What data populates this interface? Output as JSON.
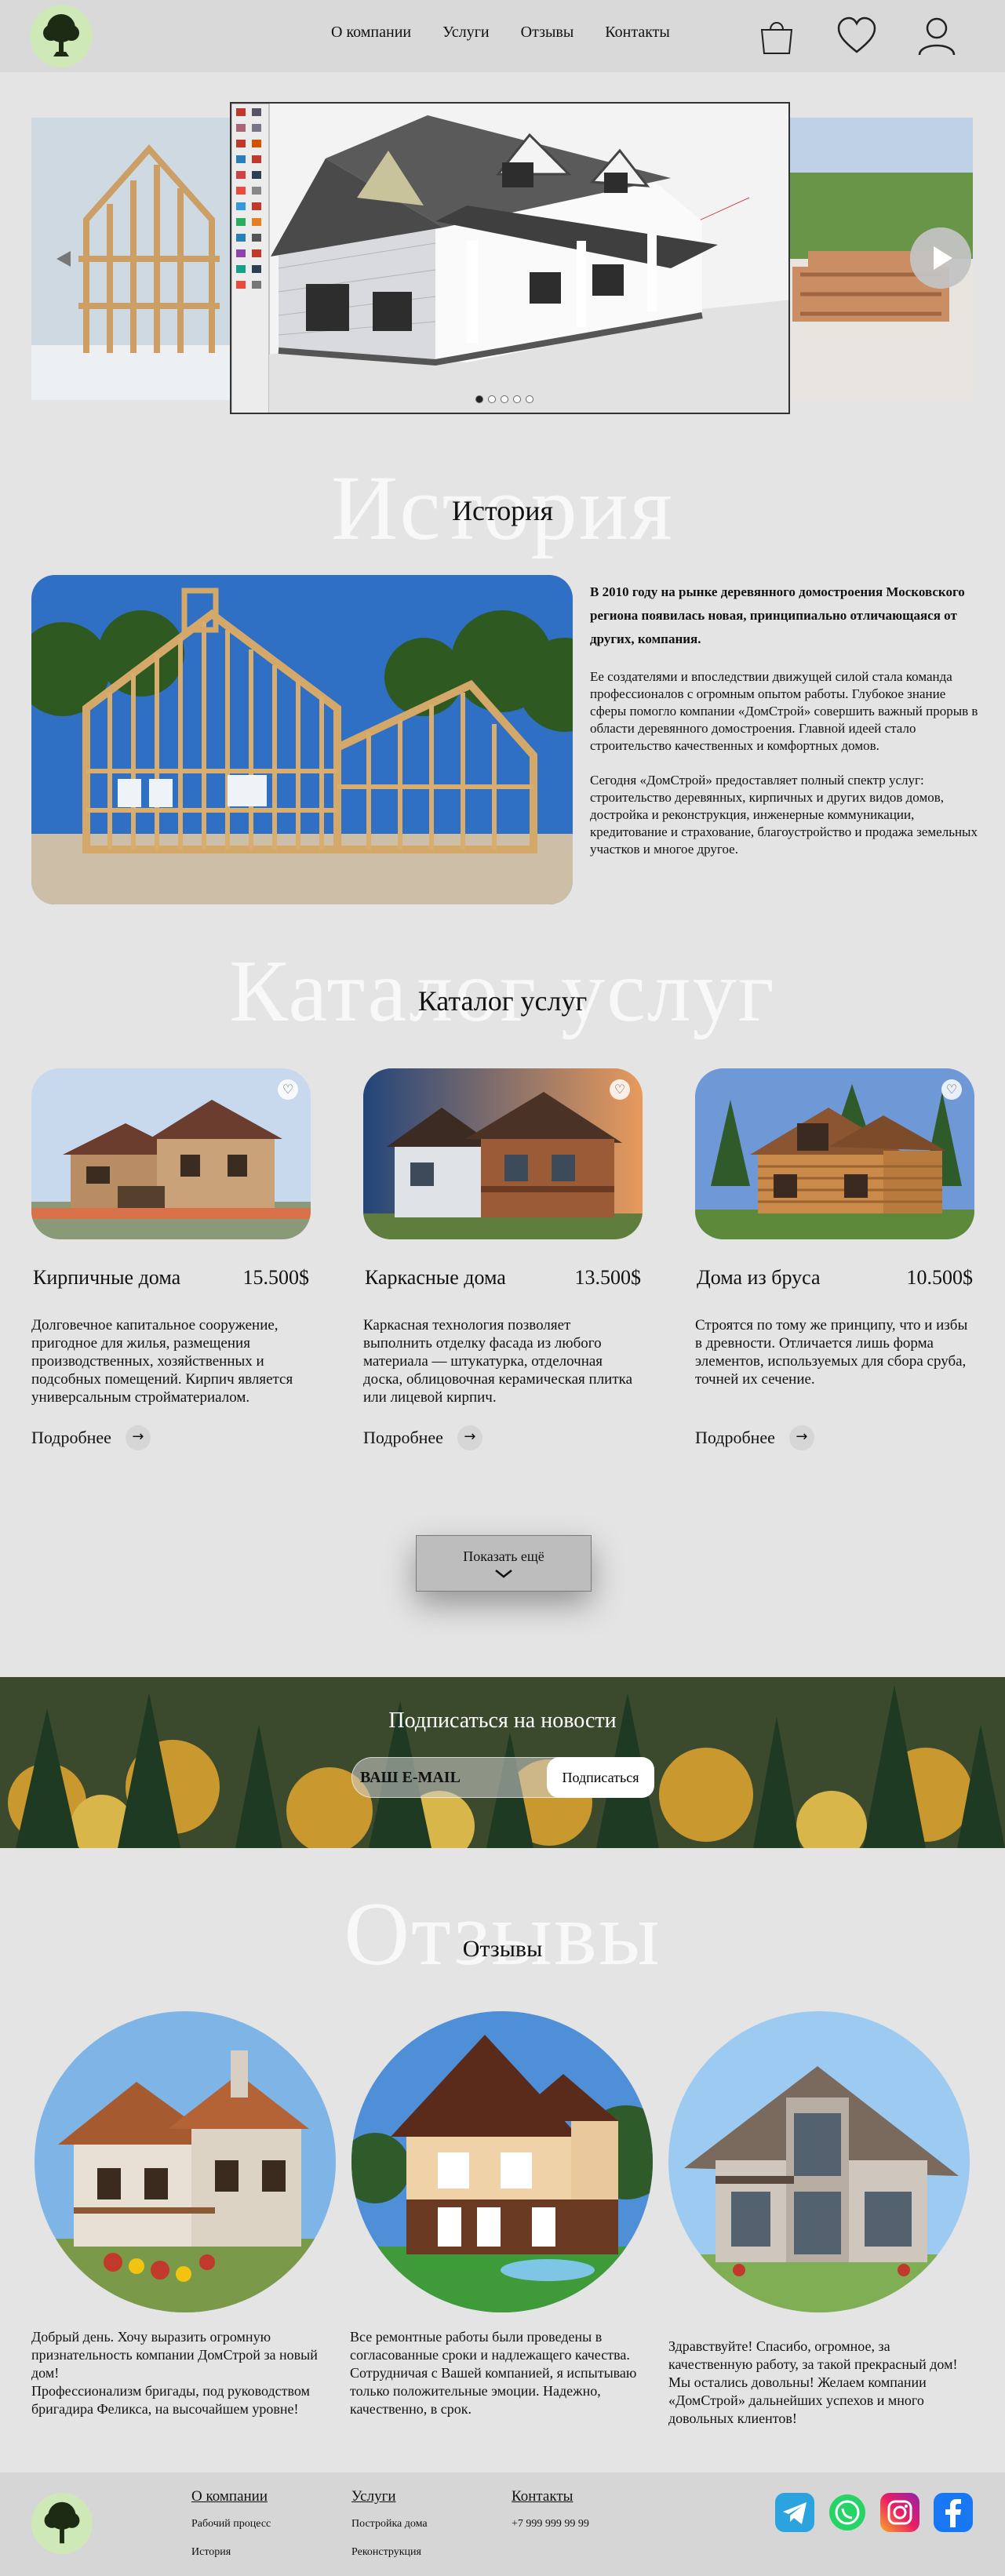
{
  "header": {
    "nav": [
      "О компании",
      "Услуги",
      "Отзывы",
      "Контакты"
    ]
  },
  "hero": {
    "slides": 5,
    "active_slide": 1
  },
  "history": {
    "ghost": "История",
    "title": "История",
    "lead": "В 2010 году на рынке деревянного домостроения Московского региона появилась новая, принципиально отличающаяся от других, компания.",
    "p1": "Ее создателями и впоследствии движущей силой стала команда профессионалов с огромным опытом работы. Глубокое знание сферы помогло компании «ДомСтрой» совершить важный прорыв в области деревянного домостроения. Главной идеей стало строительство качественных и комфортных домов.",
    "p2": "Сегодня «ДомСтрой» предоставляет полный спектр услуг: строительство деревянных, кирпичных и других видов домов, достройка и реконструкция, инженерные коммуникации, кредитование и страхование, благоустройство и продажа земельных участков и многое другое."
  },
  "catalog": {
    "ghost": "Каталог услуг",
    "title": "Каталог услуг",
    "cards": [
      {
        "name": "Кирпичные дома",
        "price": "15.500$",
        "desc": "Долговечное капитальное сооружение, пригодное для жилья, размещения производственных, хозяйственных и подсобных помещений. Кирпич является универсальным стройматериалом.",
        "more": "Подробнее"
      },
      {
        "name": "Каркасные дома",
        "price": "13.500$",
        "desc": "Каркасная технология позволяет выполнить отделку фасада из любого материала — штукатурка, отделочная доска, облицовочная керамическая плитка или лицевой кирпич.",
        "more": "Подробнее"
      },
      {
        "name": "Дома из бруса",
        "price": "10.500$",
        "desc": "Строятся по тому же принципу, что и избы в древности. Отличается лишь форма элементов, используемых для сбора сруба, точней их сечение.",
        "more": "Подробнее"
      }
    ],
    "show_more": "Показать ещё"
  },
  "newsletter": {
    "title": "Подписаться на новости",
    "email_placeholder": "ВАШ E-MAIL",
    "button": "Подписаться"
  },
  "reviews": {
    "ghost": "Отзывы",
    "title": "Отзывы",
    "items": [
      "Добрый день. Хочу выразить огромную признательность компании ДомСтрой за новый дом!\nПрофессионализм бригады, под руководством бригадира Феликса, на высочайшем уровне!",
      "Все ремонтные работы были проведены в согласованные сроки и надлежащего качества.\nСотрудничая с Вашей компанией, я испытываю только положительные эмоции. Надежно, качественно, в срок.",
      "Здравствуйте! Спасибо, огромное, за качественную работу, за такой прекрасный дом! Мы остались довольны! Желаем компании «ДомСтрой» дальнейших успехов и много довольных клиентов!"
    ]
  },
  "footer": {
    "col1": {
      "head": "О компании",
      "links": [
        "Рабочий процесс",
        "История"
      ]
    },
    "col2": {
      "head": "Услуги",
      "links": [
        "Постройка дома",
        "Реконструкция"
      ]
    },
    "col3": {
      "head": "Контакты",
      "links": [
        "+7 999 999 99 99"
      ]
    }
  },
  "colors": {
    "background": "#e4e4e4",
    "header": "#d9d9d9",
    "footer": "#d6d6d6",
    "telegram": "#2aa3df",
    "whatsapp": "#25d366",
    "facebook": "#1877f2"
  }
}
